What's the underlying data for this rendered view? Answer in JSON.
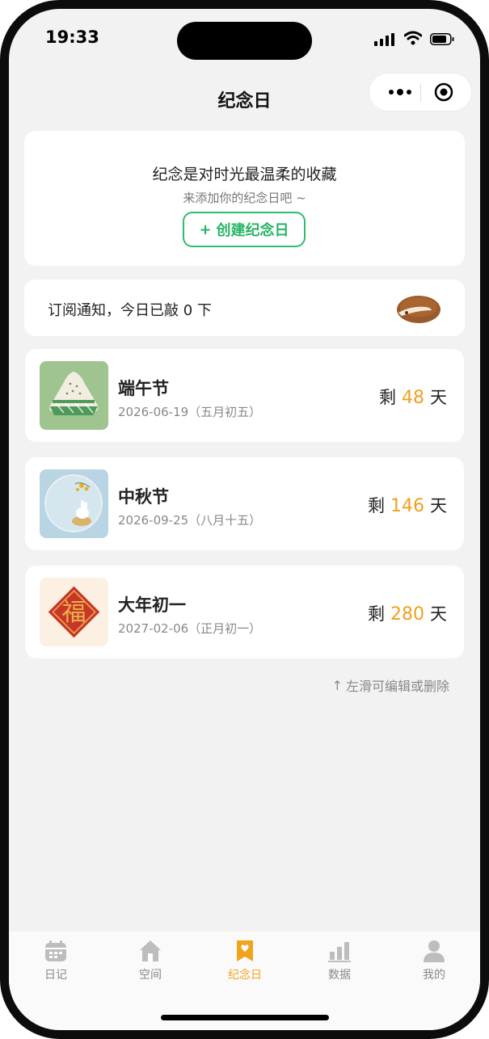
{
  "status_bar": {
    "time": "19:33"
  },
  "nav": {
    "title": "纪念日"
  },
  "intro": {
    "title": "纪念是对时光最温柔的收藏",
    "subtitle": "来添加你的纪念日吧 ~",
    "create_button": "创建纪念日",
    "create_icon": "+"
  },
  "subscribe": {
    "text": "订阅通知，今日已敲 0 下",
    "icon": "wooden-fish-icon"
  },
  "events": [
    {
      "name": "端午节",
      "date": "2026-06-19（五月初五）",
      "remain_prefix": "剩",
      "days": "48",
      "remain_suffix": "天",
      "thumb": "zongzi"
    },
    {
      "name": "中秋节",
      "date": "2026-09-25（八月十五）",
      "remain_prefix": "剩",
      "days": "146",
      "remain_suffix": "天",
      "thumb": "moon-rabbit"
    },
    {
      "name": "大年初一",
      "date": "2027-02-06（正月初一）",
      "remain_prefix": "剩",
      "days": "280",
      "remain_suffix": "天",
      "thumb": "fu",
      "fu_char": "福"
    }
  ],
  "hint": {
    "arrow": "↑",
    "text": "左滑可编辑或删除"
  },
  "tabbar": {
    "items": [
      {
        "label": "日记",
        "icon": "calendar-icon"
      },
      {
        "label": "空间",
        "icon": "home-icon"
      },
      {
        "label": "纪念日",
        "icon": "bookmark-heart-icon",
        "active": true
      },
      {
        "label": "数据",
        "icon": "bar-chart-icon"
      },
      {
        "label": "我的",
        "icon": "user-icon"
      }
    ]
  },
  "colors": {
    "accent": "#f2a31d",
    "green": "#25b565",
    "days": "#f0a020"
  }
}
